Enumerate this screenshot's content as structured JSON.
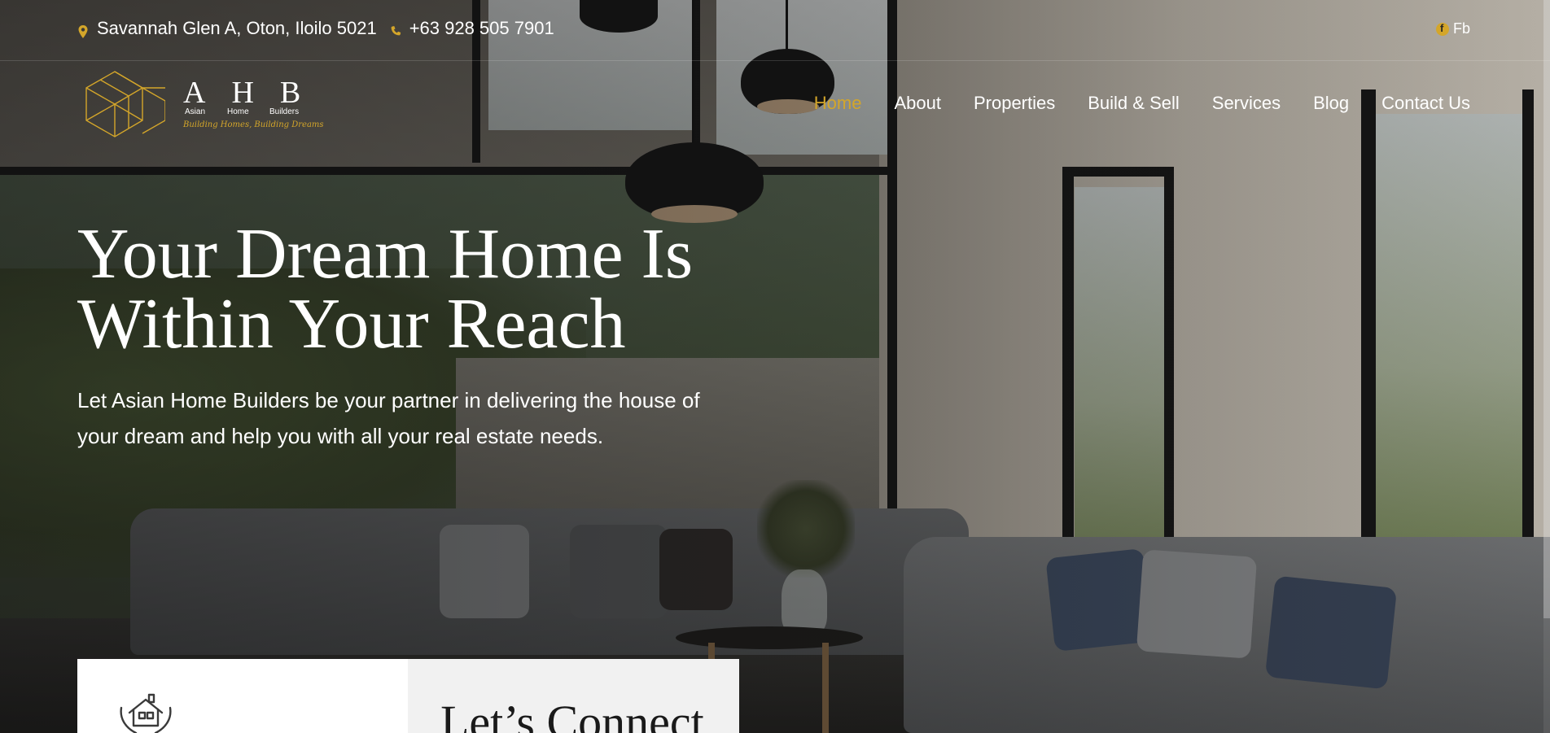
{
  "topbar": {
    "address": "Savannah Glen A, Oton, Iloilo 5021",
    "phone": "+63 928 505 7901",
    "facebook_label": "Fb"
  },
  "logo": {
    "letters": [
      "A",
      "H",
      "B"
    ],
    "words": [
      "Asian",
      "Home",
      "Builders"
    ],
    "tagline": "Building Homes, Building Dreams"
  },
  "nav": {
    "items": [
      {
        "label": "Home",
        "active": true
      },
      {
        "label": "About",
        "active": false
      },
      {
        "label": "Properties",
        "active": false
      },
      {
        "label": "Build & Sell",
        "active": false
      },
      {
        "label": "Services",
        "active": false
      },
      {
        "label": "Blog",
        "active": false
      },
      {
        "label": "Contact Us",
        "active": false
      }
    ]
  },
  "hero": {
    "title": "Your Dream Home Is Within Your Reach",
    "text": "Let Asian Home Builders be your partner in delivering the house of your dream and help you with all your real estate needs."
  },
  "cards": {
    "connect_title": "Let’s Connect"
  },
  "colors": {
    "accent": "#d4a62a",
    "text_light": "#ffffff",
    "card_white": "#ffffff",
    "card_grey": "#f1f1f1"
  },
  "icons": {
    "address": "map-pin-icon",
    "phone": "phone-icon",
    "facebook": "facebook-icon",
    "card": "house-in-hands-icon"
  }
}
